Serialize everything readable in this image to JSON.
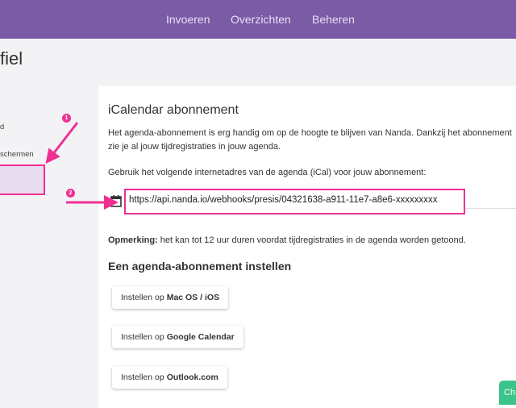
{
  "nav": {
    "items": [
      {
        "label": "Invoeren"
      },
      {
        "label": "Overzichten"
      },
      {
        "label": "Beheren"
      }
    ]
  },
  "page": {
    "title": "fiel"
  },
  "sidebar": {
    "items": [
      {
        "label": "d"
      },
      {
        "label": "schermen"
      }
    ]
  },
  "card": {
    "title": "iCalendar abonnement",
    "intro": "Het agenda-abonnement is erg handig om op de hoogte te blijven van Nanda. Dankzij het abonnement zie je al jouw tijdregistraties in jouw agenda.",
    "url_label": "Gebruik het volgende internetadres van de agenda (iCal) voor jouw abonnement:",
    "url": "https://api.nanda.io/webhooks/presis/04321638-a911-11e7-a8e6-xxxxxxxxx",
    "remark_label": "Opmerking:",
    "remark_text": " het kan tot 12 uur duren voordat tijdregistraties in de agenda worden getoond.",
    "section_title": "Een agenda-abonnement instellen",
    "buttons": [
      {
        "prefix": "Instellen op",
        "target": "Mac OS / iOS"
      },
      {
        "prefix": "Instellen op",
        "target": "Google Calendar"
      },
      {
        "prefix": "Instellen op",
        "target": "Outlook.com"
      }
    ]
  },
  "annotations": {
    "badge1": "1",
    "badge2": "2",
    "color": "#ef2f93"
  },
  "chat": {
    "label": "Ch"
  },
  "colors": {
    "header": "#7b5aa6",
    "accent": "#ef2f93",
    "chat": "#3cc48a"
  }
}
